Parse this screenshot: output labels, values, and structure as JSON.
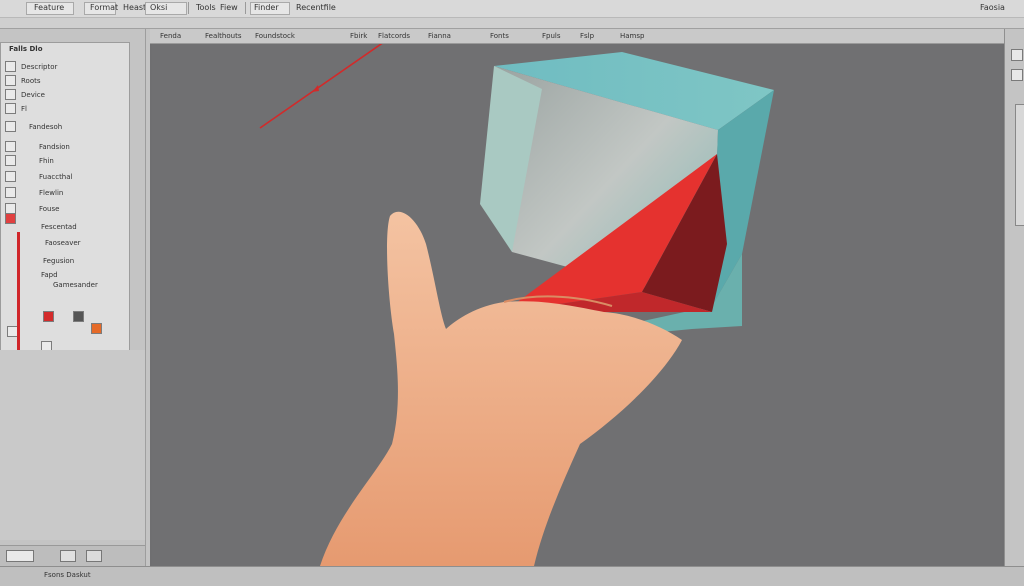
{
  "menubar": {
    "items": [
      "Feature",
      "Format",
      "Heasts",
      "Tools",
      "Fiew",
      "Finder",
      "Recentfile"
    ],
    "extras": [
      "Oksi",
      "Faosia"
    ]
  },
  "toolbar": {
    "items": [
      "Fenda",
      "Fealthouts",
      "Foundstock",
      "Flatcords",
      "Fianna",
      "Fonts",
      "Fpuls"
    ],
    "extras": [
      "Fbirk",
      "Fslp",
      "Hamsp"
    ]
  },
  "left_panel": {
    "header": "Falls Dlo",
    "items": [
      "Descriptor",
      "Roots",
      "Device",
      "Fl",
      "Fandesoh",
      "Fandsion",
      "Fhin",
      "Fuaccthal",
      "Flewlin",
      "Fouse",
      "Fescentad",
      "Faoseaver",
      "Fegusion",
      "Fapd",
      "Gamesander"
    ]
  },
  "footer": {
    "status": "Fsons Daskut"
  },
  "colors": {
    "cube_teal": "#7cc2c4",
    "cube_red": "#e5322f",
    "accent_red": "#d0262a",
    "skin": "#f0b58f"
  },
  "icons": [
    "select-tool-icon",
    "move-tool-icon",
    "rotate-tool-icon",
    "scale-tool-icon",
    "color-swatch-icon",
    "camera-icon",
    "dropdown-icon"
  ]
}
